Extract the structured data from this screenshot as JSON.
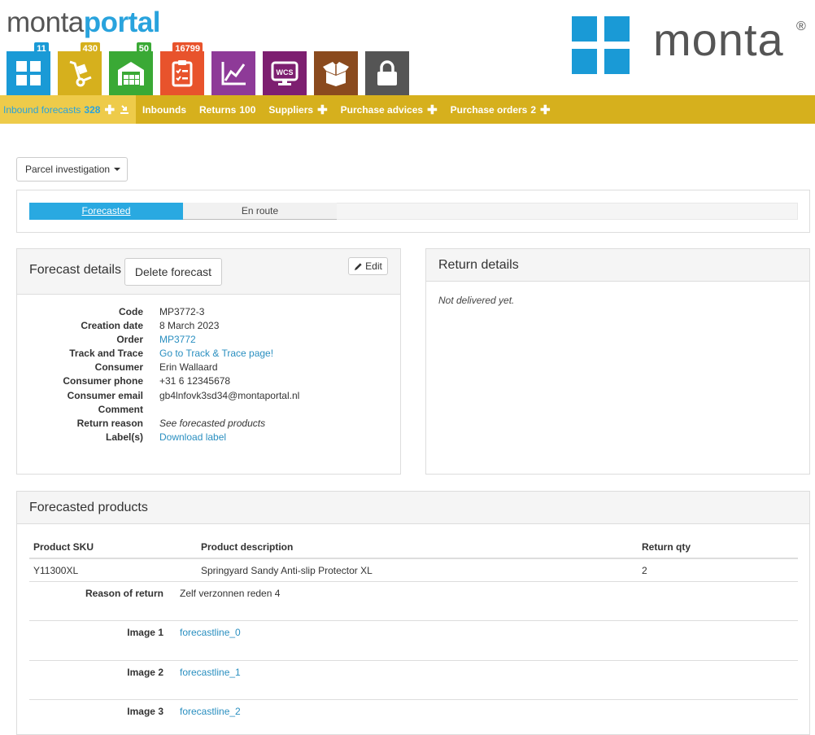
{
  "brand": {
    "part1": "monta",
    "part2": "portal"
  },
  "logo": {
    "word": "monta",
    "reg": "®"
  },
  "tiles": [
    {
      "icon": "grid-icon",
      "color": "#1a9ad6",
      "badge": "11",
      "badge_color": "#1a9ad6"
    },
    {
      "icon": "hand-truck-icon",
      "color": "#d6b01d",
      "badge": "430",
      "badge_color": "#d6b01d"
    },
    {
      "icon": "warehouse-icon",
      "color": "#3aa935",
      "badge": "50",
      "badge_color": "#3aa935"
    },
    {
      "icon": "checklist-icon",
      "color": "#e8532c",
      "badge": "16799",
      "badge_color": "#e8532c"
    },
    {
      "icon": "chart-icon",
      "color": "#8e3a98",
      "badge": "",
      "badge_color": ""
    },
    {
      "icon": "wcs-icon",
      "color": "#7d1f70",
      "badge": "",
      "badge_color": ""
    },
    {
      "icon": "box-icon",
      "color": "#8a4a1e",
      "badge": "",
      "badge_color": ""
    },
    {
      "icon": "lock-icon",
      "color": "#555555",
      "badge": "",
      "badge_color": ""
    }
  ],
  "nav": {
    "inbound_forecasts": {
      "label": "Inbound forecasts",
      "count": "328"
    },
    "inbounds": {
      "label": "Inbounds"
    },
    "returns": {
      "label": "Returns",
      "count": "100"
    },
    "suppliers": {
      "label": "Suppliers"
    },
    "purchase_advices": {
      "label": "Purchase advices"
    },
    "purchase_orders": {
      "label": "Purchase orders",
      "count": "2"
    }
  },
  "dropdown": {
    "label": "Parcel investigation"
  },
  "progress": {
    "step1": "Forecasted",
    "step2": "En route"
  },
  "forecast_details": {
    "title": "Forecast details",
    "delete_label": "Delete forecast",
    "edit_label": "Edit",
    "rows": [
      {
        "k": "Code",
        "v": "MP3772-3"
      },
      {
        "k": "Creation date",
        "v": "8 March 2023"
      },
      {
        "k": "Order",
        "v": "MP3772"
      },
      {
        "k": "Track and Trace",
        "v": "Go to Track & Trace page!"
      },
      {
        "k": "Consumer",
        "v": "Erin Wallaard"
      },
      {
        "k": "Consumer phone",
        "v": "+31 6 12345678"
      },
      {
        "k": "Consumer email",
        "v": "gb4lnfovk3sd34@montaportal.nl"
      },
      {
        "k": "Comment",
        "v": ""
      },
      {
        "k": "Return reason",
        "v": "See forecasted products"
      },
      {
        "k": "Label(s)",
        "v": "Download label"
      }
    ]
  },
  "return_details": {
    "title": "Return details",
    "message": "Not delivered yet."
  },
  "forecasted_products": {
    "title": "Forecasted products",
    "headers": {
      "sku": "Product SKU",
      "description": "Product description",
      "qty": "Return qty"
    },
    "row": {
      "sku": "Y11300XL",
      "description": "Springyard Sandy Anti-slip Protector XL",
      "qty": "2"
    },
    "reason_label": "Reason of return",
    "reason_value": "Zelf verzonnen reden 4",
    "images": [
      {
        "label": "Image 1",
        "link": "forecastline_0"
      },
      {
        "label": "Image 2",
        "link": "forecastline_1"
      },
      {
        "label": "Image 3",
        "link": "forecastline_2"
      }
    ]
  }
}
